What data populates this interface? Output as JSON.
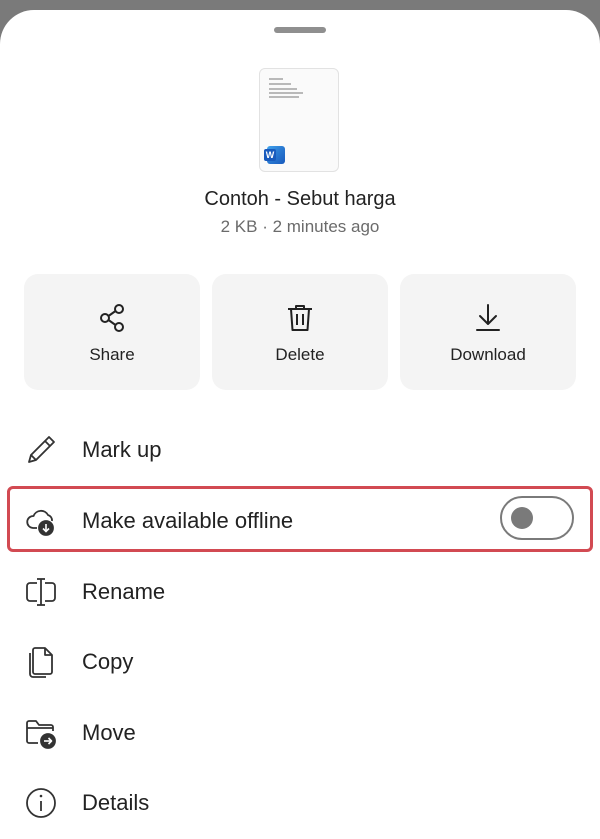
{
  "file": {
    "name": "Contoh - Sebut harga",
    "meta": "2 KB · 2 minutes ago",
    "app_icon": "word-icon",
    "app_icon_letter": "W"
  },
  "actions": [
    {
      "id": "share",
      "label": "Share",
      "icon": "share-icon"
    },
    {
      "id": "delete",
      "label": "Delete",
      "icon": "trash-icon"
    },
    {
      "id": "download",
      "label": "Download",
      "icon": "download-icon"
    }
  ],
  "menu": [
    {
      "id": "mark-up",
      "label": "Mark up",
      "icon": "pencil-icon"
    },
    {
      "id": "offline",
      "label": "Make available offline",
      "icon": "cloud-download-icon",
      "toggle": false
    },
    {
      "id": "rename",
      "label": "Rename",
      "icon": "rename-icon"
    },
    {
      "id": "copy",
      "label": "Copy",
      "icon": "copy-icon"
    },
    {
      "id": "move",
      "label": "Move",
      "icon": "folder-move-icon"
    },
    {
      "id": "details",
      "label": "Details",
      "icon": "info-icon"
    }
  ],
  "colors": {
    "highlight": "#d24a52",
    "card_bg": "#f4f4f4",
    "text": "#222222",
    "meta_text": "#6b6b6b"
  }
}
